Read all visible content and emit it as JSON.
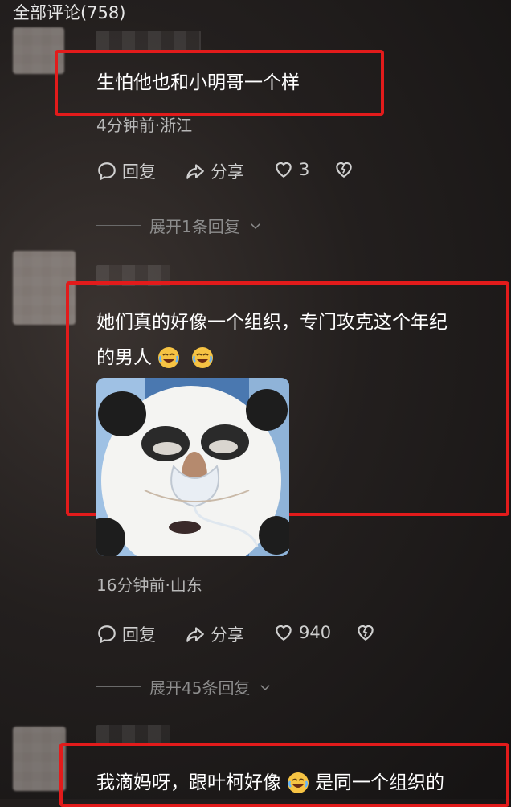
{
  "header": {
    "title": "全部评论(758)"
  },
  "comments": [
    {
      "text": "生怕他也和小明哥一个样",
      "meta": "4分钟前·浙江",
      "reply_label": "回复",
      "share_label": "分享",
      "like_count": "3",
      "expand_label": "展开1条回复"
    },
    {
      "text_line1": "她们真的好像一个组织，专门攻克这个年纪",
      "text_line2": "的男人",
      "meta": "16分钟前·山东",
      "reply_label": "回复",
      "share_label": "分享",
      "like_count": "940",
      "expand_label": "展开45条回复"
    },
    {
      "text_part1": "我滴妈呀，跟叶柯好像",
      "text_part2": "是同一个组织的"
    }
  ],
  "colors": {
    "highlight": "#e21b1b",
    "text": "#ffffff",
    "meta": "#b8b8b8"
  },
  "icons": [
    "comment-icon",
    "share-icon",
    "heart-icon",
    "dislike-icon",
    "chevron-down-icon",
    "laugh-cry-emoji"
  ]
}
